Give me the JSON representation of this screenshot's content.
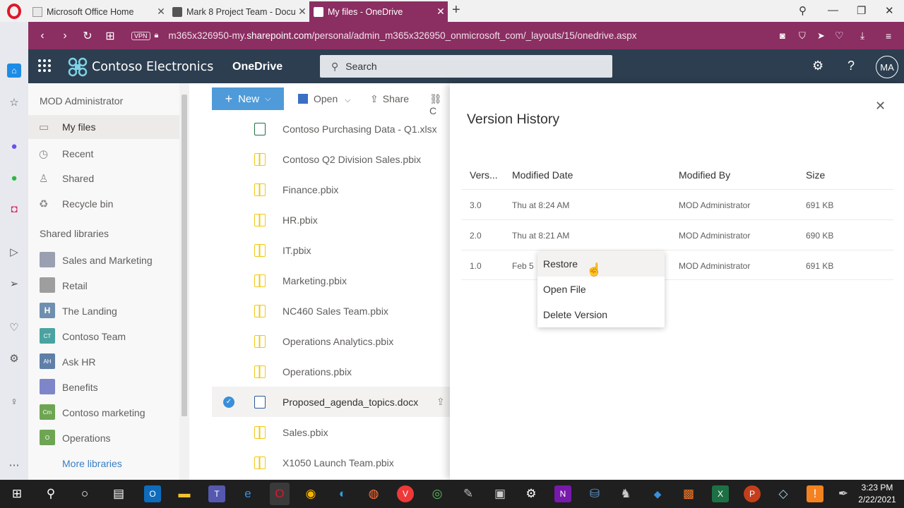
{
  "browser": {
    "tabs": [
      {
        "title": "Microsoft Office Home",
        "active": false
      },
      {
        "title": "Mark 8 Project Team - Docu",
        "active": false
      },
      {
        "title": "My files - OneDrive",
        "active": true
      }
    ],
    "new_tab": "+",
    "url_prefix": "m365x326950-my.",
    "url_domain": "sharepoint.com",
    "url_path": "/personal/admin_m365x326950_onmicrosoft_com/_layouts/15/onedrive.aspx",
    "vpn_label": "VPN",
    "accent": "#8b2e62"
  },
  "suite": {
    "brand": "Contoso Electronics",
    "app": "OneDrive",
    "search_placeholder": "Search",
    "avatar": "MA"
  },
  "leftnav": {
    "user": "MOD Administrator",
    "items": [
      {
        "label": "My files",
        "icon": "folder-icon",
        "selected": true
      },
      {
        "label": "Recent",
        "icon": "clock-icon"
      },
      {
        "label": "Shared",
        "icon": "people-icon"
      },
      {
        "label": "Recycle bin",
        "icon": "trash-icon"
      }
    ],
    "shared_libraries_title": "Shared libraries",
    "libraries": [
      {
        "label": "Sales and Marketing",
        "badge": "",
        "color": "#9aa0b2"
      },
      {
        "label": "Retail",
        "badge": "",
        "color": "#9e9e9e"
      },
      {
        "label": "The Landing",
        "badge": "H",
        "color": "#6e8fb0"
      },
      {
        "label": "Contoso Team",
        "badge": "CT",
        "color": "#4aa3a1"
      },
      {
        "label": "Ask HR",
        "badge": "AH",
        "color": "#5e7fa8"
      },
      {
        "label": "Benefits",
        "badge": "",
        "color": "#7e86c9"
      },
      {
        "label": "Contoso marketing",
        "badge": "Cm",
        "color": "#6ea553"
      },
      {
        "label": "Operations",
        "badge": "O",
        "color": "#6ea553"
      }
    ],
    "more_libraries": "More libraries"
  },
  "commandbar": {
    "new_label": "New",
    "open_label": "Open",
    "share_label": "Share",
    "copy_label": "C"
  },
  "files": [
    {
      "name": "Contoso Purchasing Data - Q1.xlsx",
      "type": "xlsx"
    },
    {
      "name": "Contoso Q2 Division Sales.pbix",
      "type": "pbix"
    },
    {
      "name": "Finance.pbix",
      "type": "pbix"
    },
    {
      "name": "HR.pbix",
      "type": "pbix"
    },
    {
      "name": "IT.pbix",
      "type": "pbix"
    },
    {
      "name": "Marketing.pbix",
      "type": "pbix"
    },
    {
      "name": "NC460 Sales Team.pbix",
      "type": "pbix"
    },
    {
      "name": "Operations Analytics.pbix",
      "type": "pbix"
    },
    {
      "name": "Operations.pbix",
      "type": "pbix"
    },
    {
      "name": "Proposed_agenda_topics.docx",
      "type": "docx",
      "selected": true
    },
    {
      "name": "Sales.pbix",
      "type": "pbix"
    },
    {
      "name": "X1050 Launch Team.pbix",
      "type": "pbix"
    }
  ],
  "version_history": {
    "title": "Version History",
    "columns": [
      "Vers...",
      "Modified Date",
      "Modified By",
      "Size"
    ],
    "rows": [
      {
        "version": "3.0",
        "date": "Thu at 8:24 AM",
        "by": "MOD Administrator",
        "size": "691 KB"
      },
      {
        "version": "2.0",
        "date": "Thu at 8:21 AM",
        "by": "MOD Administrator",
        "size": "690 KB"
      },
      {
        "version": "1.0",
        "date": "Feb 5",
        "by": "MOD Administrator",
        "size": "691 KB"
      }
    ],
    "context_menu": [
      "Restore",
      "Open File",
      "Delete Version"
    ]
  },
  "taskbar": {
    "time": "3:23 PM",
    "date": "2/22/2021"
  }
}
